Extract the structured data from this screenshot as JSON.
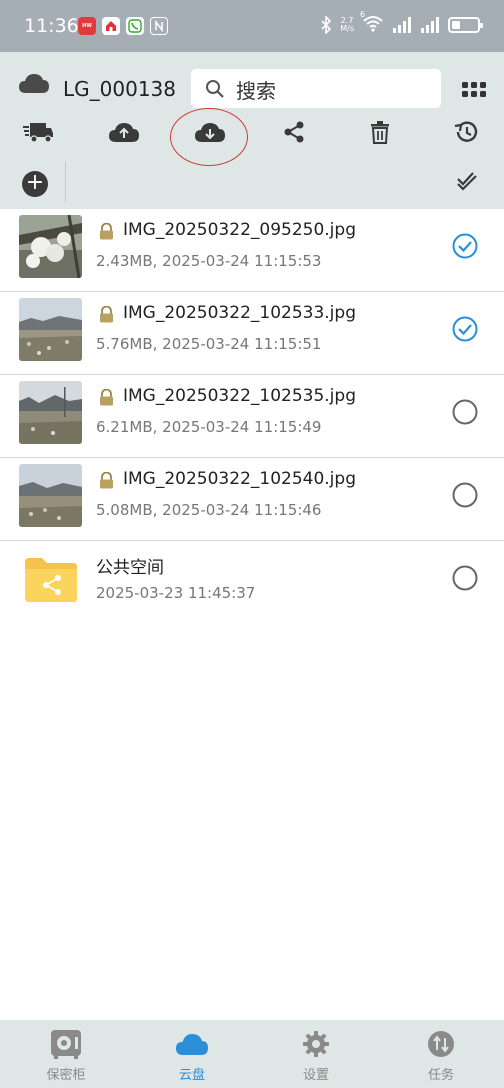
{
  "status_bar": {
    "time": "11:36",
    "speed_value": "2.7",
    "speed_unit": "M/s",
    "network_tag": "6"
  },
  "header": {
    "account_name": "LG_000138",
    "search_placeholder": "搜索"
  },
  "toolbar": {
    "icons": [
      "transfer-truck-icon",
      "cloud-upload-icon",
      "cloud-download-icon",
      "share-icon",
      "trash-icon",
      "history-icon"
    ],
    "highlighted": "cloud-download-icon"
  },
  "files": [
    {
      "name": "IMG_20250322_095250.jpg",
      "meta": "2.43MB, 2025-03-24 11:15:53",
      "checked": true,
      "locked": true
    },
    {
      "name": "IMG_20250322_102533.jpg",
      "meta": "5.76MB, 2025-03-24 11:15:51",
      "checked": true,
      "locked": true
    },
    {
      "name": "IMG_20250322_102535.jpg",
      "meta": "6.21MB, 2025-03-24 11:15:49",
      "checked": false,
      "locked": true
    },
    {
      "name": "IMG_20250322_102540.jpg",
      "meta": "5.08MB, 2025-03-24 11:15:46",
      "checked": false,
      "locked": true
    }
  ],
  "folder": {
    "name": "公共空间",
    "meta": "2025-03-23 11:45:37",
    "checked": false
  },
  "bottom_nav": [
    {
      "label": "保密柜",
      "icon": "safe-icon",
      "active": false
    },
    {
      "label": "云盘",
      "icon": "cloud-icon",
      "active": true
    },
    {
      "label": "设置",
      "icon": "gear-icon",
      "active": false
    },
    {
      "label": "任务",
      "icon": "transfer-icon",
      "active": false
    }
  ],
  "colors": {
    "header_bg": "#dfe7e6",
    "accent": "#2a8fd8",
    "status_bar": "#a6aeb5",
    "highlight": "#d23a35"
  }
}
